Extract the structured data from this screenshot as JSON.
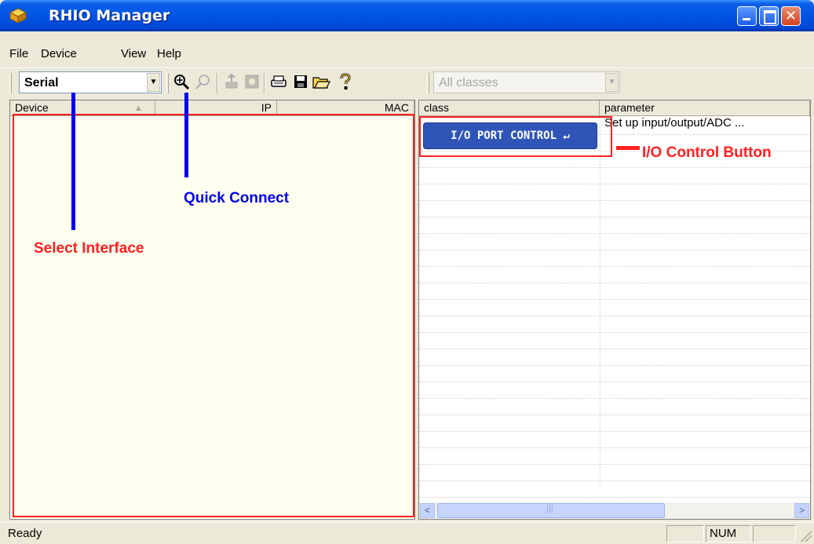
{
  "window": {
    "title": "RHIO Manager",
    "icon": "app-cube-icon",
    "close_glyph": "✕"
  },
  "menu": {
    "file": "File",
    "device": "Device",
    "view": "View",
    "help": "Help"
  },
  "toolbar": {
    "interface_value": "Serial",
    "class_filter_value": "All classes",
    "icons": [
      "quick-connect-icon",
      "search-icon",
      "upload-icon",
      "refresh-icon",
      "print-icon",
      "save-icon",
      "open-folder-icon",
      "help-icon"
    ]
  },
  "left_pane": {
    "columns": [
      "Device",
      "IP",
      "MAC"
    ]
  },
  "right_pane": {
    "columns": [
      "class",
      "parameter"
    ],
    "io_button_label": "I/O PORT CONTROL ↵",
    "first_row_parameter": "Set up input/output/ADC ..."
  },
  "annotations": {
    "select_interface": "Select Interface",
    "quick_connect": "Quick Connect",
    "io_control": "I/O Control Button"
  },
  "status": {
    "text": "Ready",
    "num": "NUM"
  },
  "colors": {
    "titlebar": "#0055e5",
    "annotation_red": "#ff2020",
    "annotation_blue": "#0000ee",
    "io_button": "#2f55b8",
    "left_pane_bg": "#fffff0"
  }
}
